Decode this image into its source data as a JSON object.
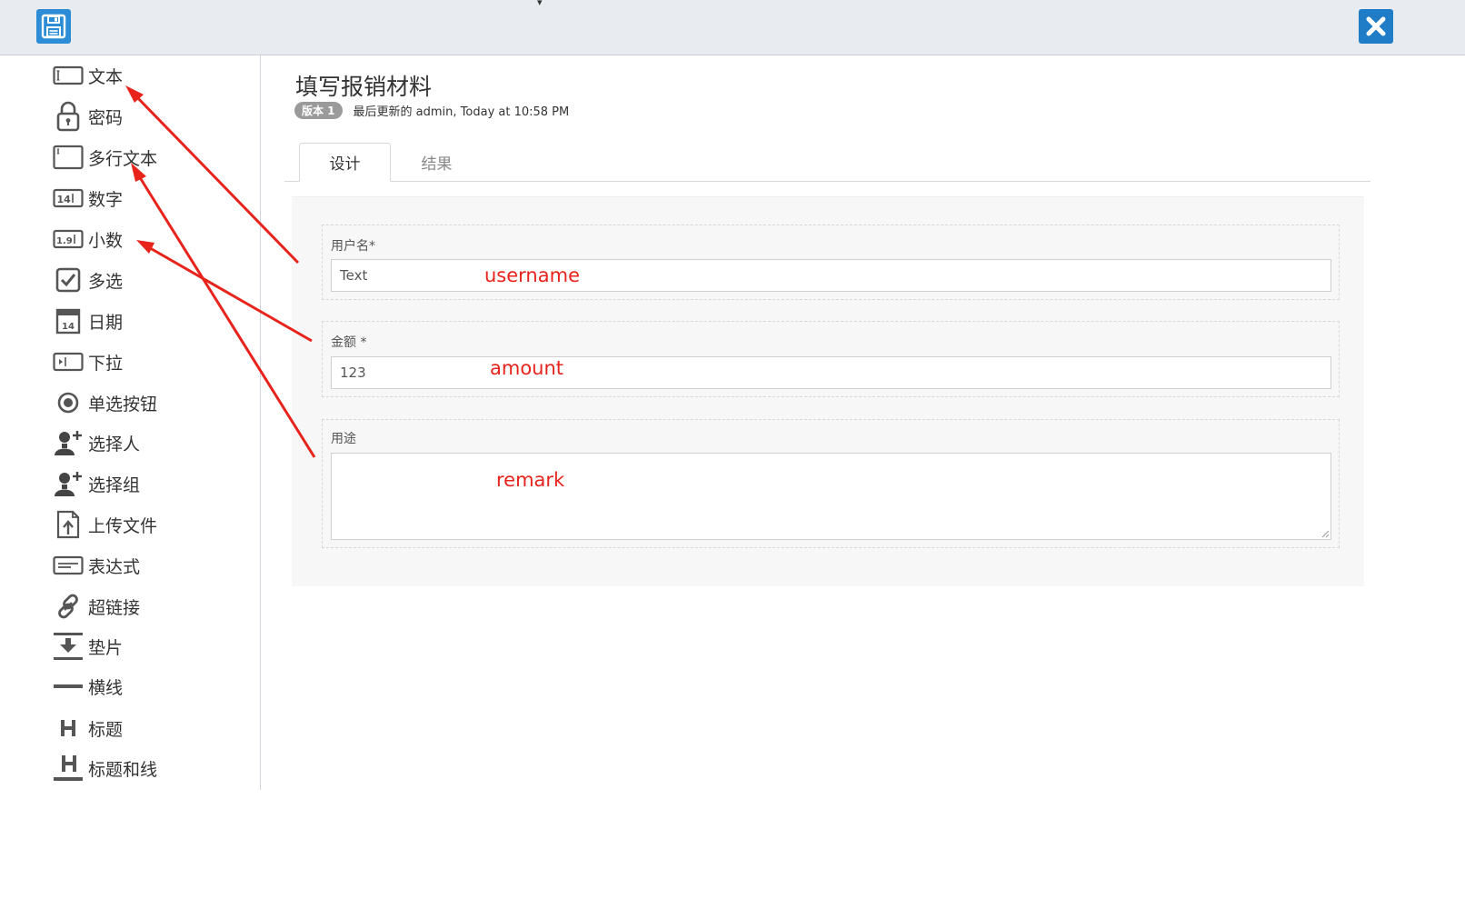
{
  "toolbar": {
    "save_icon": "save-icon",
    "close_icon": "close-icon",
    "save_color": "#2c8dd6",
    "close_color": "#1f7cc6"
  },
  "sidebar": {
    "items": [
      {
        "label": "文本",
        "icon": "text-field-icon"
      },
      {
        "label": "密码",
        "icon": "lock-icon"
      },
      {
        "label": "多行文本",
        "icon": "textarea-icon"
      },
      {
        "label": "数字",
        "icon": "number-icon"
      },
      {
        "label": "小数",
        "icon": "decimal-icon"
      },
      {
        "label": "多选",
        "icon": "checkbox-icon"
      },
      {
        "label": "日期",
        "icon": "calendar-icon"
      },
      {
        "label": "下拉",
        "icon": "dropdown-icon"
      },
      {
        "label": "单选按钮",
        "icon": "radio-icon"
      },
      {
        "label": "选择人",
        "icon": "add-user-icon"
      },
      {
        "label": "选择组",
        "icon": "add-group-icon"
      },
      {
        "label": "上传文件",
        "icon": "upload-file-icon"
      },
      {
        "label": "表达式",
        "icon": "expression-icon"
      },
      {
        "label": "超链接",
        "icon": "link-icon"
      },
      {
        "label": "垫片",
        "icon": "spacer-icon"
      },
      {
        "label": "横线",
        "icon": "horizontal-line-icon"
      },
      {
        "label": "标题",
        "icon": "heading-icon"
      },
      {
        "label": "标题和线",
        "icon": "heading-line-icon"
      }
    ]
  },
  "form": {
    "title": "填写报销材料",
    "version_badge": "版本 1",
    "updated_text": "最后更新的 admin, Today at 10:58 PM"
  },
  "tabs": [
    {
      "label": "设计",
      "active": true
    },
    {
      "label": "结果",
      "active": false
    }
  ],
  "fields": [
    {
      "label": "用户名*",
      "value": "Text",
      "annotation": "username"
    },
    {
      "label": "金额 *",
      "value": "123",
      "annotation": "amount"
    },
    {
      "label": "用途",
      "value": "",
      "annotation": "remark"
    }
  ],
  "annotation_color": "#e8231b"
}
